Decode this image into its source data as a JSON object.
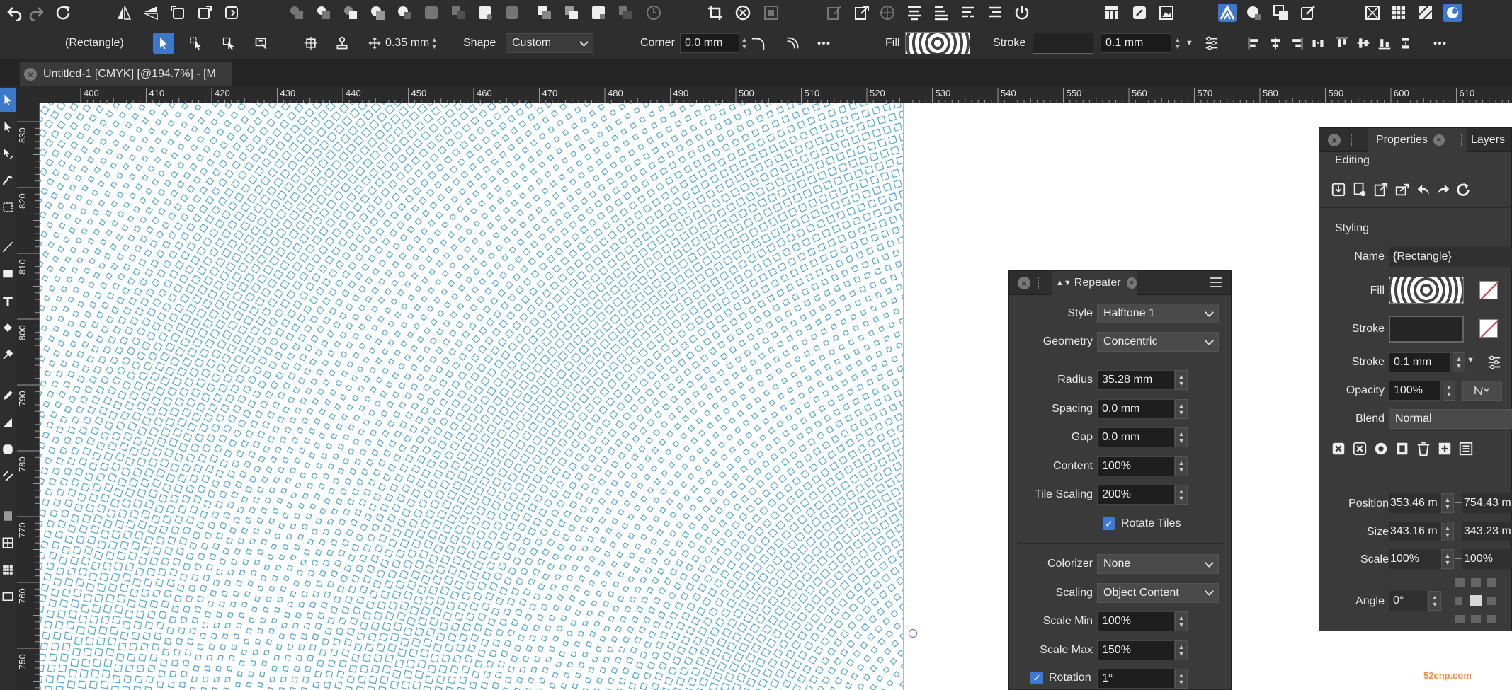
{
  "colors": {
    "accent": "#3e78c8",
    "halftone": "#4aa3c9"
  },
  "context_bar": {
    "object_name": "(Rectangle)",
    "width_value": "0.35 mm",
    "shape_label": "Shape",
    "shape_value": "Custom",
    "corner_label": "Corner",
    "corner_value": "0.0 mm",
    "fill_label": "Fill",
    "stroke_label": "Stroke",
    "stroke_width": "0.1 mm"
  },
  "document_tab": {
    "title": "Untitled-1 [CMYK] [@194.7%] - [M"
  },
  "rulers": {
    "top": [
      "400",
      "410",
      "420",
      "430",
      "440",
      "450",
      "460",
      "470",
      "480",
      "490",
      "500",
      "510",
      "520",
      "530",
      "540",
      "550",
      "560",
      "570",
      "580",
      "590",
      "600",
      "610"
    ],
    "left": [
      "830",
      "820",
      "810",
      "800",
      "790",
      "780",
      "770",
      "760",
      "750"
    ]
  },
  "repeater_panel": {
    "title": "Repeater",
    "rows": [
      {
        "label": "Style",
        "value": "Halftone 1",
        "type": "dropdown"
      },
      {
        "label": "Geometry",
        "value": "Concentric",
        "type": "dropdown"
      },
      {
        "label": "Radius",
        "value": "35.28 mm",
        "type": "number"
      },
      {
        "label": "Spacing",
        "value": "0.0 mm",
        "type": "number"
      },
      {
        "label": "Gap",
        "value": "0.0 mm",
        "type": "number"
      },
      {
        "label": "Content",
        "value": "100%",
        "type": "number"
      },
      {
        "label": "Tile Scaling",
        "value": "200%",
        "type": "number"
      }
    ],
    "rotate_tiles_label": "Rotate Tiles",
    "rows2": [
      {
        "label": "Colorizer",
        "value": "None",
        "type": "dropdown"
      },
      {
        "label": "Scaling",
        "value": "Object Content",
        "type": "dropdown"
      },
      {
        "label": "Scale Min",
        "value": "100%",
        "type": "number"
      },
      {
        "label": "Scale Max",
        "value": "150%",
        "type": "number"
      }
    ],
    "rotation_label": "Rotation",
    "rotation_value": "1°"
  },
  "properties_panel": {
    "tab_properties": "Properties",
    "tab_layers": "Layers",
    "editing_label": "Editing",
    "styling_label": "Styling",
    "name_label": "Name",
    "name_value": "{Rectangle}",
    "fill_label": "Fill",
    "stroke_label": "Stroke",
    "stroke_width_label": "Stroke",
    "stroke_width_value": "0.1 mm",
    "opacity_label": "Opacity",
    "opacity_value": "100%",
    "blend_label": "Blend",
    "blend_value": "Normal",
    "position_label": "Position",
    "position_x": "353.46 m",
    "position_y": "754.43 m",
    "size_label": "Size",
    "size_w": "343.16 m",
    "size_h": "343.23 m",
    "scale_label": "Scale",
    "scale_x": "100%",
    "scale_y": "100%",
    "angle_label": "Angle",
    "angle_value": "0°"
  },
  "watermark": {
    "text": "52cnp.com"
  }
}
